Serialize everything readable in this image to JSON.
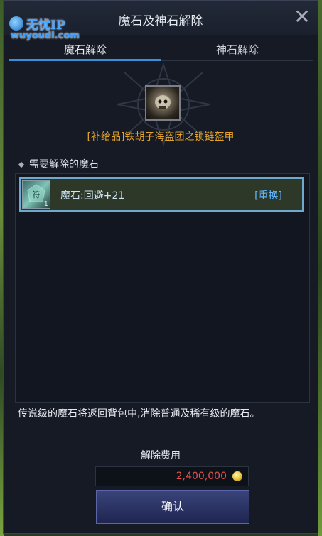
{
  "window": {
    "title": "魔石及神石解除"
  },
  "watermark": {
    "name": "无忧IP",
    "url": "wuyoudl.com"
  },
  "tabs": [
    {
      "label": "魔石解除"
    },
    {
      "label": "神石解除"
    }
  ],
  "item": {
    "name": "[补给品]铁胡子海盗团之锁链盔甲",
    "icon": "chainmail-armor-icon"
  },
  "section": {
    "label": "需要解除的魔石"
  },
  "gems": [
    {
      "name": "魔石:回避+21",
      "count": "1",
      "action": "[重换]",
      "icon": "magic-stone-icon"
    }
  ],
  "notice": "传说级的魔石将返回背包中,消除普通及稀有级的魔石。",
  "cost": {
    "label": "解除费用",
    "value": "2,400,000",
    "icon": "gold-coin-icon"
  },
  "confirm": {
    "label": "确认"
  },
  "colors": {
    "accent": "#3b8fd8",
    "item_name": "#e3a32c",
    "cost": "#e55050",
    "replace": "#63b6ff"
  }
}
